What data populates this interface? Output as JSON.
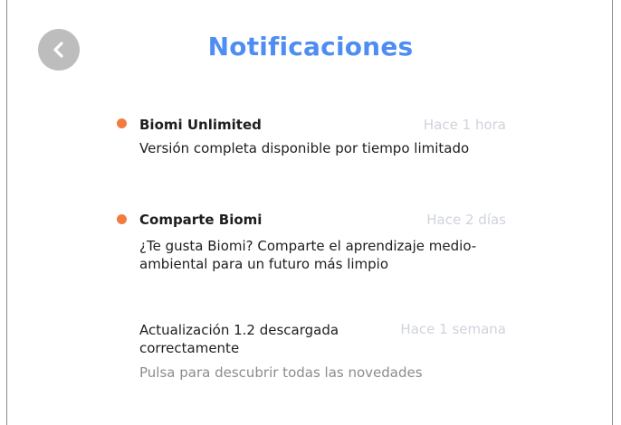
{
  "header": {
    "title": "Notificaciones",
    "back_icon": "chevron-left-icon"
  },
  "colors": {
    "accent": "#4e8df2",
    "unread_dot": "#f27c3f",
    "time_text": "#cfd3dc",
    "back_button_bg": "#bdbdbd"
  },
  "notifications": [
    {
      "unread": true,
      "title": "Biomi Unlimited",
      "time": "Hace 1 hora",
      "body": "Versión completa disponible por tiempo limitado"
    },
    {
      "unread": true,
      "title": "Comparte Biomi",
      "time": "Hace 2 días",
      "body": "¿Te gusta Biomi? Comparte el aprendizaje medio-ambiental para un futuro más limpio"
    },
    {
      "unread": false,
      "title": "Actualización 1.2 descargada correctamente",
      "time": "Hace 1 semana",
      "body": "Pulsa para descubrir todas las novedades"
    }
  ]
}
